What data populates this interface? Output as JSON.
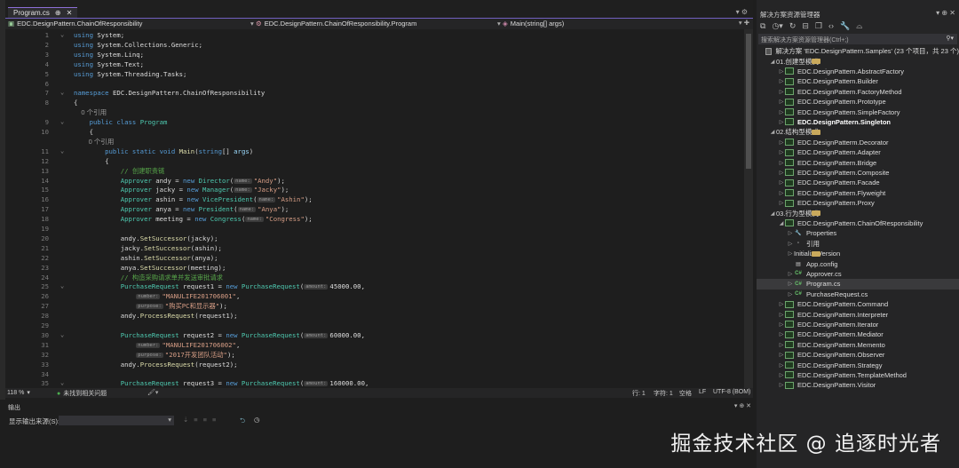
{
  "tab": {
    "label": "Program.cs",
    "pin": "⊕",
    "close": "✕"
  },
  "nav": {
    "project": "EDC.DesignPattern.ChainOfResponsibility",
    "class": "EDC.DesignPattern.ChainOfResponsibility.Program",
    "member": "Main(string[] args)"
  },
  "code": [
    {
      "n": "1",
      "fold": "⌄",
      "t": [
        [
          "using",
          "kw"
        ],
        [
          " System;",
          "tx"
        ]
      ]
    },
    {
      "n": "2",
      "t": [
        [
          "using",
          "kw"
        ],
        [
          " System.Collections.Generic;",
          "tx"
        ]
      ]
    },
    {
      "n": "3",
      "t": [
        [
          "using",
          "kw"
        ],
        [
          " System.Linq;",
          "tx"
        ]
      ]
    },
    {
      "n": "4",
      "t": [
        [
          "using",
          "kw"
        ],
        [
          " System.Text;",
          "tx"
        ]
      ]
    },
    {
      "n": "5",
      "t": [
        [
          "using",
          "kw"
        ],
        [
          " System.Threading.Tasks;",
          "tx"
        ]
      ]
    },
    {
      "n": "6",
      "t": []
    },
    {
      "n": "7",
      "fold": "⌄",
      "t": [
        [
          "namespace",
          "kw"
        ],
        [
          " EDC.DesignPattern.ChainOfResponsibility",
          "tx"
        ]
      ]
    },
    {
      "n": "8",
      "t": [
        [
          "{",
          "tx"
        ]
      ]
    },
    {
      "lens": "    0 个引用"
    },
    {
      "n": "9",
      "fold": "⌄",
      "t": [
        [
          "    public class ",
          "kw"
        ],
        [
          "Program",
          "ty"
        ]
      ]
    },
    {
      "n": "10",
      "t": [
        [
          "    {",
          "tx"
        ]
      ]
    },
    {
      "lens": "        0 个引用"
    },
    {
      "n": "11",
      "fold": "⌄",
      "t": [
        [
          "        public static void ",
          "kw"
        ],
        [
          "Main",
          "mt"
        ],
        [
          "(",
          "tx"
        ],
        [
          "string",
          "kw"
        ],
        [
          "[] ",
          "tx"
        ],
        [
          "args",
          "vr"
        ],
        [
          ")",
          "tx"
        ]
      ]
    },
    {
      "n": "12",
      "t": [
        [
          "        {",
          "tx"
        ]
      ]
    },
    {
      "n": "13",
      "t": [
        [
          "            // 创建职责链",
          "cm"
        ]
      ]
    },
    {
      "n": "14",
      "t": [
        [
          "            Approver",
          "ty"
        ],
        [
          " andy = ",
          "tx"
        ],
        [
          "new ",
          "kw"
        ],
        [
          "Director",
          "ty"
        ],
        [
          "(",
          "tx"
        ],
        [
          "name:",
          "hint"
        ],
        [
          "\"Andy\"",
          "st"
        ],
        [
          ");",
          "tx"
        ]
      ]
    },
    {
      "n": "15",
      "t": [
        [
          "            Approver",
          "ty"
        ],
        [
          " jacky = ",
          "tx"
        ],
        [
          "new ",
          "kw"
        ],
        [
          "Manager",
          "ty"
        ],
        [
          "(",
          "tx"
        ],
        [
          "name:",
          "hint"
        ],
        [
          "\"Jacky\"",
          "st"
        ],
        [
          ");",
          "tx"
        ]
      ]
    },
    {
      "n": "16",
      "t": [
        [
          "            Approver",
          "ty"
        ],
        [
          " ashin = ",
          "tx"
        ],
        [
          "new ",
          "kw"
        ],
        [
          "VicePresident",
          "ty"
        ],
        [
          "(",
          "tx"
        ],
        [
          "name:",
          "hint"
        ],
        [
          "\"Ashin\"",
          "st"
        ],
        [
          ");",
          "tx"
        ]
      ]
    },
    {
      "n": "17",
      "t": [
        [
          "            Approver",
          "ty"
        ],
        [
          " anya = ",
          "tx"
        ],
        [
          "new ",
          "kw"
        ],
        [
          "President",
          "ty"
        ],
        [
          "(",
          "tx"
        ],
        [
          "name:",
          "hint"
        ],
        [
          "\"Anya\"",
          "st"
        ],
        [
          ");",
          "tx"
        ]
      ]
    },
    {
      "n": "18",
      "t": [
        [
          "            Approver",
          "ty"
        ],
        [
          " meeting = ",
          "tx"
        ],
        [
          "new ",
          "kw"
        ],
        [
          "Congress",
          "ty"
        ],
        [
          "(",
          "tx"
        ],
        [
          "name:",
          "hint"
        ],
        [
          "\"Congress\"",
          "st"
        ],
        [
          ");",
          "tx"
        ]
      ]
    },
    {
      "n": "19",
      "t": []
    },
    {
      "n": "20",
      "t": [
        [
          "            andy.",
          "tx"
        ],
        [
          "SetSuccessor",
          "mt"
        ],
        [
          "(jacky);",
          "tx"
        ]
      ]
    },
    {
      "n": "21",
      "t": [
        [
          "            jacky.",
          "tx"
        ],
        [
          "SetSuccessor",
          "mt"
        ],
        [
          "(ashin);",
          "tx"
        ]
      ]
    },
    {
      "n": "22",
      "t": [
        [
          "            ashin.",
          "tx"
        ],
        [
          "SetSuccessor",
          "mt"
        ],
        [
          "(anya);",
          "tx"
        ]
      ]
    },
    {
      "n": "23",
      "t": [
        [
          "            anya.",
          "tx"
        ],
        [
          "SetSuccessor",
          "mt"
        ],
        [
          "(meeting);",
          "tx"
        ]
      ]
    },
    {
      "n": "24",
      "t": [
        [
          "            // 构造采购请求单并发送审批请求",
          "cm"
        ]
      ]
    },
    {
      "n": "25",
      "fold": "⌄",
      "t": [
        [
          "            PurchaseRequest",
          "ty"
        ],
        [
          " request1 = ",
          "tx"
        ],
        [
          "new ",
          "kw"
        ],
        [
          "PurchaseRequest",
          "ty"
        ],
        [
          "(",
          "tx"
        ],
        [
          "amount:",
          "hint"
        ],
        [
          "45000.00,",
          "tx"
        ]
      ]
    },
    {
      "n": "26",
      "t": [
        [
          "                ",
          "tx"
        ],
        [
          "number:",
          "hint"
        ],
        [
          "\"MANULIFE201706001\"",
          "st"
        ],
        [
          ",",
          "tx"
        ]
      ]
    },
    {
      "n": "27",
      "t": [
        [
          "                ",
          "tx"
        ],
        [
          "purpose:",
          "hint"
        ],
        [
          "\"购买PC和显示器\"",
          "st"
        ],
        [
          ");",
          "tx"
        ]
      ]
    },
    {
      "n": "28",
      "t": [
        [
          "            andy.",
          "tx"
        ],
        [
          "ProcessRequest",
          "mt"
        ],
        [
          "(request1);",
          "tx"
        ]
      ]
    },
    {
      "n": "29",
      "t": []
    },
    {
      "n": "30",
      "fold": "⌄",
      "t": [
        [
          "            PurchaseRequest",
          "ty"
        ],
        [
          " request2 = ",
          "tx"
        ],
        [
          "new ",
          "kw"
        ],
        [
          "PurchaseRequest",
          "ty"
        ],
        [
          "(",
          "tx"
        ],
        [
          "amount:",
          "hint"
        ],
        [
          "60000.00,",
          "tx"
        ]
      ]
    },
    {
      "n": "31",
      "t": [
        [
          "                ",
          "tx"
        ],
        [
          "number:",
          "hint"
        ],
        [
          "\"MANULIFE201706002\"",
          "st"
        ],
        [
          ",",
          "tx"
        ]
      ]
    },
    {
      "n": "32",
      "t": [
        [
          "                ",
          "tx"
        ],
        [
          "purpose:",
          "hint"
        ],
        [
          "\"2017开发团队活动\"",
          "st"
        ],
        [
          ");",
          "tx"
        ]
      ]
    },
    {
      "n": "33",
      "t": [
        [
          "            andy.",
          "tx"
        ],
        [
          "ProcessRequest",
          "mt"
        ],
        [
          "(request2);",
          "tx"
        ]
      ]
    },
    {
      "n": "34",
      "t": []
    },
    {
      "n": "35",
      "fold": "⌄",
      "t": [
        [
          "            PurchaseRequest",
          "ty"
        ],
        [
          " request3 = ",
          "tx"
        ],
        [
          "new ",
          "kw"
        ],
        [
          "PurchaseRequest",
          "ty"
        ],
        [
          "(",
          "tx"
        ],
        [
          "amount:",
          "hint"
        ],
        [
          "160000.00,",
          "tx"
        ]
      ]
    }
  ],
  "status": {
    "zoom": "118 %",
    "issues": "未找到相关问题",
    "line": "行: 1",
    "char": "字符: 1",
    "space": "空格",
    "eol": "LF",
    "encoding": "UTF-8 (BOM)"
  },
  "output": {
    "title": "输出",
    "source_label": "显示输出来源(S):",
    "source_value": ""
  },
  "solution_explorer": {
    "title": "解决方案资源管理器",
    "search_placeholder": "搜索解决方案资源管理器(Ctrl+;)",
    "items": [
      {
        "lvl": 0,
        "ic": "sln",
        "label": "解决方案 'EDC.DesignPattern.Samples' (23 个项目，共 23 个)"
      },
      {
        "lvl": 1,
        "exp": "◢",
        "ic": "fold",
        "label": "01.创建型模式"
      },
      {
        "lvl": 2,
        "exp": "▷",
        "ic": "proj",
        "label": "EDC.DesignPattern.AbstractFactory"
      },
      {
        "lvl": 2,
        "exp": "▷",
        "ic": "proj",
        "label": "EDC.DesignPattern.Builder"
      },
      {
        "lvl": 2,
        "exp": "▷",
        "ic": "proj",
        "label": "EDC.DesignPattern.FactoryMethod"
      },
      {
        "lvl": 2,
        "exp": "▷",
        "ic": "proj",
        "label": "EDC.DesignPattern.Prototype"
      },
      {
        "lvl": 2,
        "exp": "▷",
        "ic": "proj",
        "label": "EDC.DesignPattern.SimpleFactory"
      },
      {
        "lvl": 2,
        "exp": "▷",
        "ic": "proj",
        "label": "EDC.DesignPattern.Singleton",
        "bold": true
      },
      {
        "lvl": 1,
        "exp": "◢",
        "ic": "fold",
        "label": "02.结构型模式"
      },
      {
        "lvl": 2,
        "exp": "▷",
        "ic": "proj",
        "label": "EDC.DesignPatterm.Decorator"
      },
      {
        "lvl": 2,
        "exp": "▷",
        "ic": "proj",
        "label": "EDC.DesignPattern.Adapter"
      },
      {
        "lvl": 2,
        "exp": "▷",
        "ic": "proj",
        "label": "EDC.DesignPattern.Bridge"
      },
      {
        "lvl": 2,
        "exp": "▷",
        "ic": "proj",
        "label": "EDC.DesignPattern.Composite"
      },
      {
        "lvl": 2,
        "exp": "▷",
        "ic": "proj",
        "label": "EDC.DesignPattern.Facade"
      },
      {
        "lvl": 2,
        "exp": "▷",
        "ic": "proj",
        "label": "EDC.DesignPattern.Flyweight"
      },
      {
        "lvl": 2,
        "exp": "▷",
        "ic": "proj",
        "label": "EDC.DesignPattern.Proxy"
      },
      {
        "lvl": 1,
        "exp": "◢",
        "ic": "fold",
        "label": "03.行为型模式"
      },
      {
        "lvl": 2,
        "exp": "◢",
        "ic": "proj",
        "label": "EDC.DesignPattern.ChainOfResponsibility"
      },
      {
        "lvl": 3,
        "exp": "▷",
        "ic": "other",
        "glyph": "🔧",
        "label": "Properties"
      },
      {
        "lvl": 3,
        "exp": "▷",
        "ic": "other",
        "glyph": "▫",
        "label": "引用"
      },
      {
        "lvl": 3,
        "exp": "▷",
        "ic": "fold",
        "label": "InitializeVersion"
      },
      {
        "lvl": 3,
        "ic": "other",
        "glyph": "▤",
        "label": "App.config"
      },
      {
        "lvl": 3,
        "exp": "▷",
        "ic": "cs",
        "glyph": "C#",
        "label": "Approver.cs"
      },
      {
        "lvl": 3,
        "exp": "▷",
        "ic": "cs",
        "glyph": "C#",
        "label": "Program.cs",
        "selected": true
      },
      {
        "lvl": 3,
        "exp": "▷",
        "ic": "cs",
        "glyph": "C#",
        "label": "PurchaseRequest.cs"
      },
      {
        "lvl": 2,
        "exp": "▷",
        "ic": "proj",
        "label": "EDC.DesignPattern.Command"
      },
      {
        "lvl": 2,
        "exp": "▷",
        "ic": "proj",
        "label": "EDC.DesignPattern.Interpreter"
      },
      {
        "lvl": 2,
        "exp": "▷",
        "ic": "proj",
        "label": "EDC.DesignPattern.Iterator"
      },
      {
        "lvl": 2,
        "exp": "▷",
        "ic": "proj",
        "label": "EDC.DesignPattern.Mediator"
      },
      {
        "lvl": 2,
        "exp": "▷",
        "ic": "proj",
        "label": "EDC.DesignPattern.Memento"
      },
      {
        "lvl": 2,
        "exp": "▷",
        "ic": "proj",
        "label": "EDC.DesignPattern.Observer"
      },
      {
        "lvl": 2,
        "exp": "▷",
        "ic": "proj",
        "label": "EDC.DesignPattern.Strategy"
      },
      {
        "lvl": 2,
        "exp": "▷",
        "ic": "proj",
        "label": "EDC.DesignPattern.TemplateMethod"
      },
      {
        "lvl": 2,
        "exp": "▷",
        "ic": "proj",
        "label": "EDC.DesignPattern.Visitor"
      }
    ]
  },
  "watermark": "掘金技术社区 @ 追逐时光者",
  "colors": {
    "keyword": "#569cd6",
    "type": "#4ec9b0",
    "string": "#d69d85",
    "comment": "#57a64a",
    "accent": "#7160c0"
  }
}
